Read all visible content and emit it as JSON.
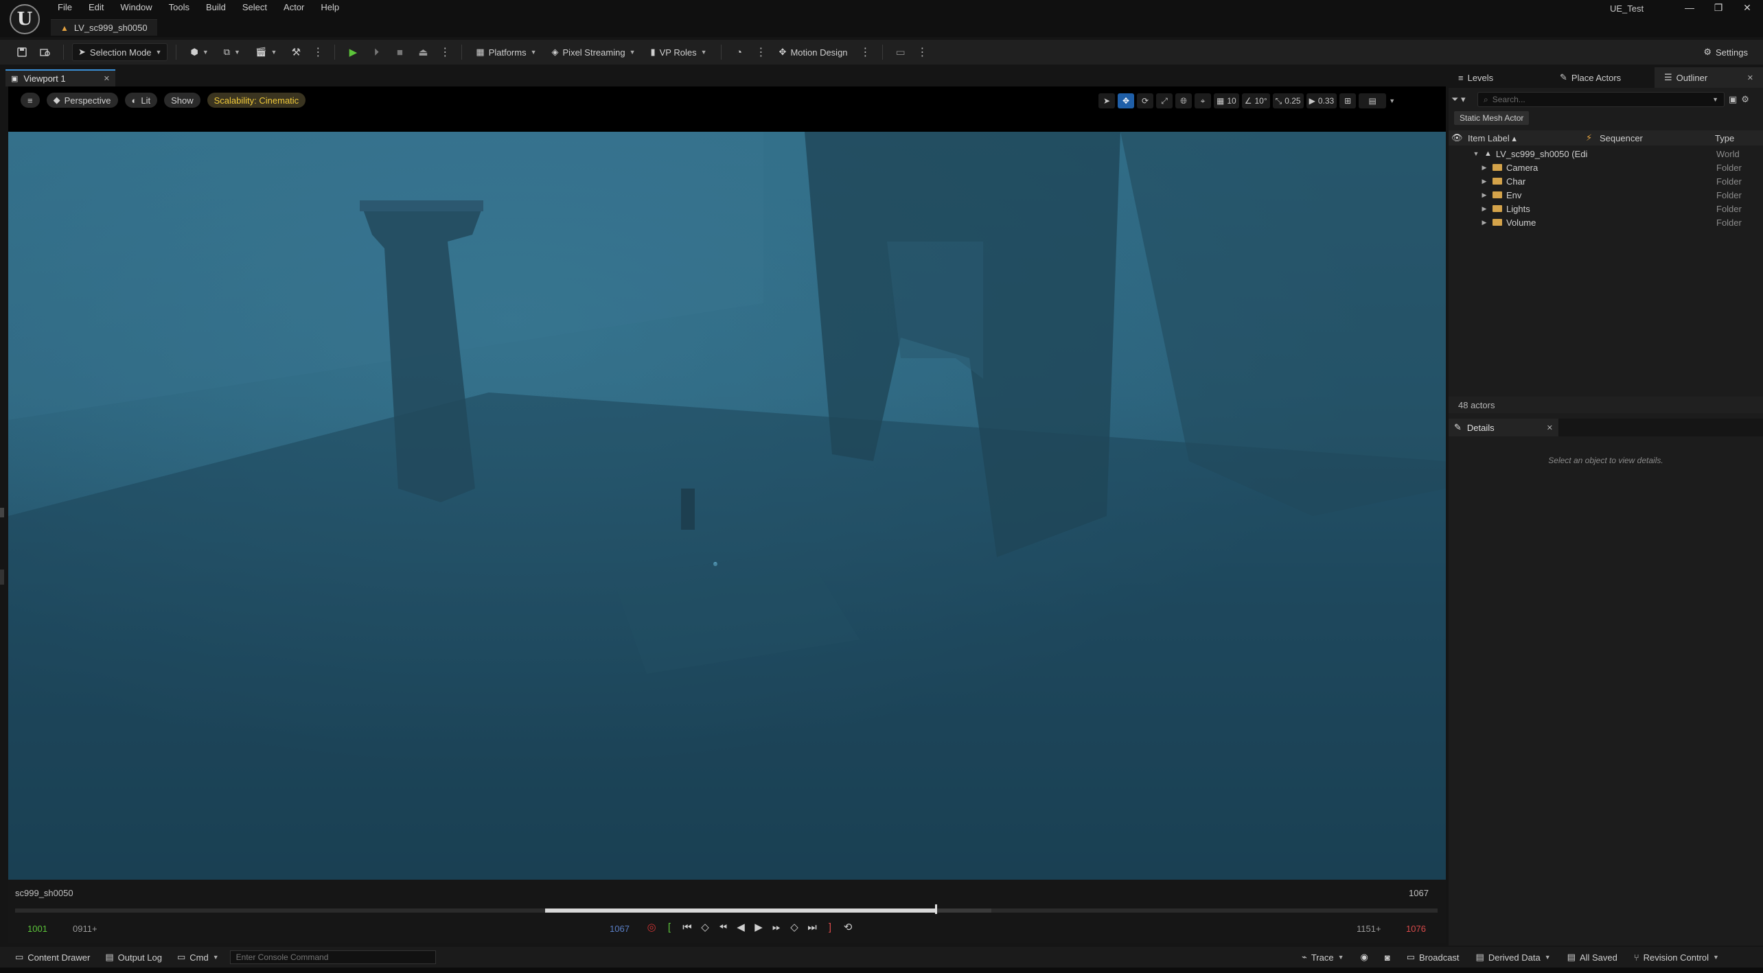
{
  "app": {
    "level_tab": "LV_sc999_sh0050",
    "project_name": "UE_Test",
    "logo_text": "U"
  },
  "menu": [
    "File",
    "Edit",
    "Window",
    "Tools",
    "Build",
    "Select",
    "Actor",
    "Help"
  ],
  "window_controls": {
    "minimize": "—",
    "maximize": "❐",
    "close": "✕"
  },
  "toolbar": {
    "selection_mode": "Selection Mode",
    "platforms": "Platforms",
    "pixel_streaming": "Pixel Streaming",
    "vp_roles": "VP Roles",
    "motion_design": "Motion Design",
    "settings": "Settings"
  },
  "viewport": {
    "tab_label": "Viewport 1",
    "perspective": "Perspective",
    "lit": "Lit",
    "show": "Show",
    "scalability": "Scalability: Cinematic",
    "grid_snap": "10",
    "rotation_snap": "10°",
    "scale_snap": "0.25",
    "camera_speed": "0.33"
  },
  "timeline": {
    "shot_name": "sc999_sh0050",
    "current_frame_right": "1067",
    "start_frame": "1001",
    "in_frame": "0911+",
    "current_frame": "1067",
    "out_frame": "1151+",
    "end_frame": "1076"
  },
  "bottom_bar": {
    "content_drawer": "Content Drawer",
    "output_log": "Output Log",
    "cmd": "Cmd",
    "console_placeholder": "Enter Console Command",
    "trace": "Trace",
    "broadcast": "Broadcast",
    "derived_data": "Derived Data",
    "all_saved": "All Saved",
    "revision_control": "Revision Control"
  },
  "right_panel": {
    "tabs": {
      "levels": "Levels",
      "place_actors": "Place Actors",
      "outliner": "Outliner"
    },
    "search_placeholder": "Search...",
    "filter_chip": "Static Mesh Actor",
    "columns": {
      "item_label": "Item Label",
      "sequencer": "Sequencer",
      "type": "Type"
    },
    "root": {
      "label": "LV_sc999_sh0050 (Edi",
      "type": "World"
    },
    "folders": [
      {
        "label": "Camera",
        "type": "Folder"
      },
      {
        "label": "Char",
        "type": "Folder"
      },
      {
        "label": "Env",
        "type": "Folder"
      },
      {
        "label": "Lights",
        "type": "Folder"
      },
      {
        "label": "Volume",
        "type": "Folder"
      }
    ],
    "actor_count": "48 actors",
    "details_tab": "Details",
    "details_empty": "Select an object to view details."
  },
  "colors": {
    "accent_blue": "#3b8fd6",
    "scene_fog": "#2a5a72",
    "play_green": "#5cc43a",
    "end_red": "#d84a4a",
    "scalability_yellow": "#f0c93a"
  }
}
